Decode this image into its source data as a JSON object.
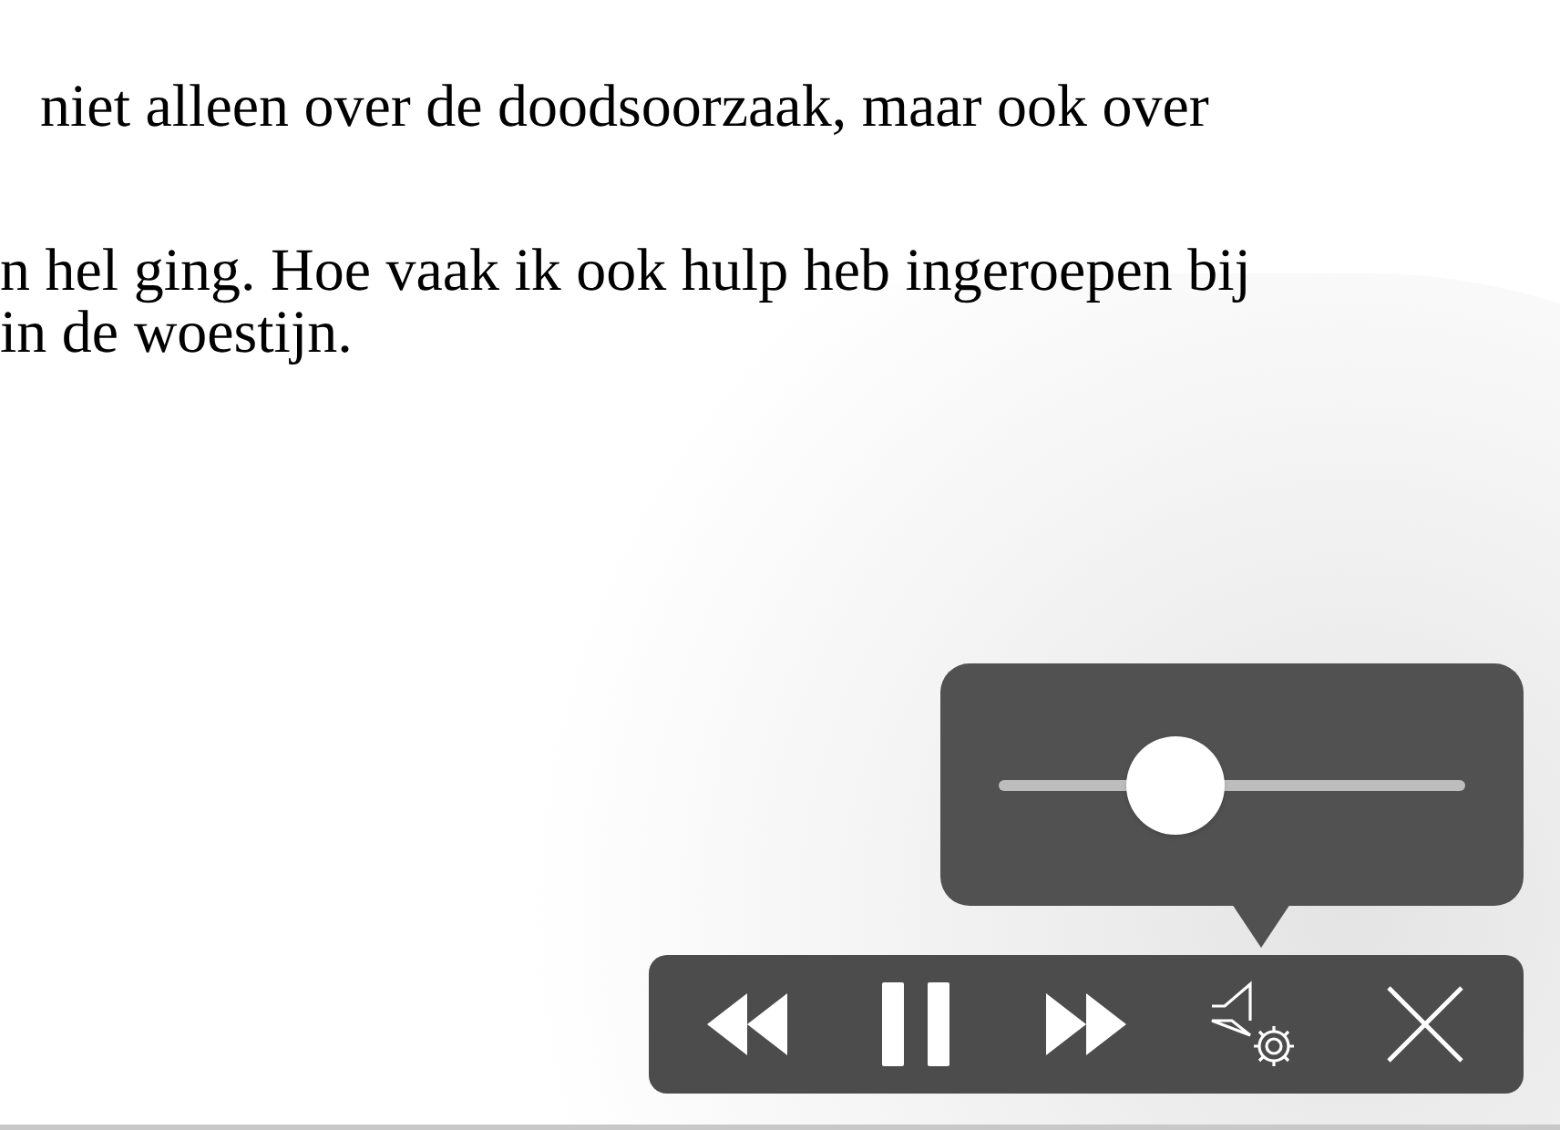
{
  "text_lines": [
    "niet alleen over de doodsoorzaak, maar ook over",
    "n hel ging. Hoe vaak ik ook hulp heb ingeroepen bij",
    "in de woestijn."
  ],
  "player": {
    "playing": true,
    "volume": {
      "level": 0.38
    }
  }
}
